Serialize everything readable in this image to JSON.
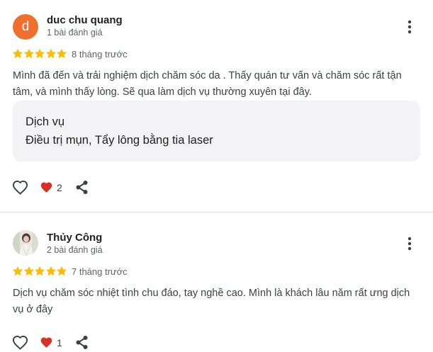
{
  "reviews": [
    {
      "author": "duc chu quang",
      "avatar_letter": "d",
      "review_count": "1 bài đánh giá",
      "rating": 5,
      "time": "8 tháng trước",
      "text": "Mình đã đến và trải nghiệm dịch chăm sóc da . Thấy quán tư vấn và chăm sóc rất tận tâm, và mình thấy lòng. Sẽ qua làm dịch vụ thường xuyên tại đây.",
      "service_label": "Dịch vụ",
      "service_value": "Điều trị mụn, Tẩy lông bằng tia laser",
      "likes": "2"
    },
    {
      "author": "Thủy Công",
      "review_count": "2 bài đánh giá",
      "rating": 5,
      "time": "7 tháng trước",
      "text": "Dịch vụ chăm sóc nhiệt tình chu đáo, tay nghề cao. Mình là khách lâu năm rất ưng dịch vụ ở đây",
      "likes": "1"
    }
  ],
  "colors": {
    "star": "#fbbc04",
    "heart": "#d93025",
    "avatar_bg": "#f06f2f",
    "divider": "#dadce0"
  },
  "icons": [
    "heart-outline-icon",
    "heart-filled-icon",
    "share-icon",
    "more-vert-icon",
    "star-icon"
  ]
}
